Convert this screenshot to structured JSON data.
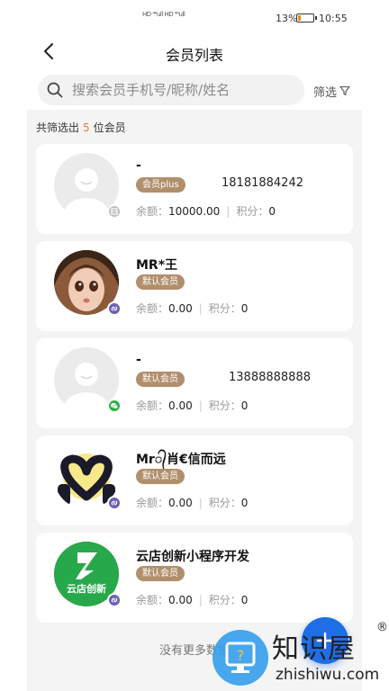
{
  "status_bar": {
    "network": "HD ⁴⁶ull HD ⁴⁶ull",
    "battery": "13%",
    "time": "10:55"
  },
  "header": {
    "title": "会员列表"
  },
  "search": {
    "placeholder": "搜索会员手机号/昵称/姓名",
    "value": ""
  },
  "filter": {
    "label": "筛选"
  },
  "summary": {
    "prefix": "共筛选出",
    "count": "5",
    "suffix": "位会员"
  },
  "labels": {
    "balance": "余额：",
    "points": "积分："
  },
  "members": [
    {
      "name": "-",
      "level": "会员plus",
      "phone": "18181884242",
      "balance": "10000.00",
      "points": "0",
      "source_icon": "store-icon",
      "avatar": "default-avatar"
    },
    {
      "name": "MR*王",
      "level": "默认会员",
      "phone": "",
      "balance": "0.00",
      "points": "0",
      "source_icon": "mini-program-icon",
      "avatar": "cartoon-girl-avatar"
    },
    {
      "name": "-",
      "level": "默认会员",
      "phone": "13888888888",
      "balance": "0.00",
      "points": "0",
      "source_icon": "wechat-icon",
      "avatar": "default-avatar"
    },
    {
      "name": "Mr᭄肖€信而远",
      "level": "默认会员",
      "phone": "",
      "balance": "0.00",
      "points": "0",
      "source_icon": "mini-program-icon",
      "avatar": "heart-hands-avatar"
    },
    {
      "name": "云店创新小程序开发",
      "level": "默认会员",
      "phone": "",
      "balance": "0.00",
      "points": "0",
      "source_icon": "mini-program-icon",
      "avatar": "yundian-logo-avatar",
      "avatar_text": "云店创新"
    }
  ],
  "footer": {
    "no_more": "没有更多数据"
  },
  "fab": {
    "icon": "plus-icon"
  },
  "watermark": {
    "main": "知识屋",
    "sub": "zhishiwu.com",
    "reg": "®"
  },
  "colors": {
    "level_tag": "#b18f6c",
    "count": "#e07b39",
    "fab": "#1e6ee6",
    "mini_program": "#6b5fb5",
    "wechat": "#2bb24c"
  }
}
